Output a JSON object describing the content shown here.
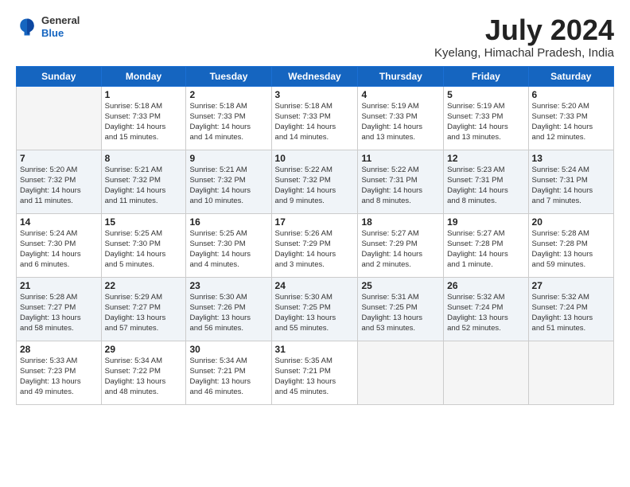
{
  "logo": {
    "general": "General",
    "blue": "Blue"
  },
  "title": "July 2024",
  "location": "Kyelang, Himachal Pradesh, India",
  "days_header": [
    "Sunday",
    "Monday",
    "Tuesday",
    "Wednesday",
    "Thursday",
    "Friday",
    "Saturday"
  ],
  "weeks": [
    [
      {
        "num": "",
        "info": ""
      },
      {
        "num": "1",
        "info": "Sunrise: 5:18 AM\nSunset: 7:33 PM\nDaylight: 14 hours\nand 15 minutes."
      },
      {
        "num": "2",
        "info": "Sunrise: 5:18 AM\nSunset: 7:33 PM\nDaylight: 14 hours\nand 14 minutes."
      },
      {
        "num": "3",
        "info": "Sunrise: 5:18 AM\nSunset: 7:33 PM\nDaylight: 14 hours\nand 14 minutes."
      },
      {
        "num": "4",
        "info": "Sunrise: 5:19 AM\nSunset: 7:33 PM\nDaylight: 14 hours\nand 13 minutes."
      },
      {
        "num": "5",
        "info": "Sunrise: 5:19 AM\nSunset: 7:33 PM\nDaylight: 14 hours\nand 13 minutes."
      },
      {
        "num": "6",
        "info": "Sunrise: 5:20 AM\nSunset: 7:33 PM\nDaylight: 14 hours\nand 12 minutes."
      }
    ],
    [
      {
        "num": "7",
        "info": "Sunrise: 5:20 AM\nSunset: 7:32 PM\nDaylight: 14 hours\nand 11 minutes."
      },
      {
        "num": "8",
        "info": "Sunrise: 5:21 AM\nSunset: 7:32 PM\nDaylight: 14 hours\nand 11 minutes."
      },
      {
        "num": "9",
        "info": "Sunrise: 5:21 AM\nSunset: 7:32 PM\nDaylight: 14 hours\nand 10 minutes."
      },
      {
        "num": "10",
        "info": "Sunrise: 5:22 AM\nSunset: 7:32 PM\nDaylight: 14 hours\nand 9 minutes."
      },
      {
        "num": "11",
        "info": "Sunrise: 5:22 AM\nSunset: 7:31 PM\nDaylight: 14 hours\nand 8 minutes."
      },
      {
        "num": "12",
        "info": "Sunrise: 5:23 AM\nSunset: 7:31 PM\nDaylight: 14 hours\nand 8 minutes."
      },
      {
        "num": "13",
        "info": "Sunrise: 5:24 AM\nSunset: 7:31 PM\nDaylight: 14 hours\nand 7 minutes."
      }
    ],
    [
      {
        "num": "14",
        "info": "Sunrise: 5:24 AM\nSunset: 7:30 PM\nDaylight: 14 hours\nand 6 minutes."
      },
      {
        "num": "15",
        "info": "Sunrise: 5:25 AM\nSunset: 7:30 PM\nDaylight: 14 hours\nand 5 minutes."
      },
      {
        "num": "16",
        "info": "Sunrise: 5:25 AM\nSunset: 7:30 PM\nDaylight: 14 hours\nand 4 minutes."
      },
      {
        "num": "17",
        "info": "Sunrise: 5:26 AM\nSunset: 7:29 PM\nDaylight: 14 hours\nand 3 minutes."
      },
      {
        "num": "18",
        "info": "Sunrise: 5:27 AM\nSunset: 7:29 PM\nDaylight: 14 hours\nand 2 minutes."
      },
      {
        "num": "19",
        "info": "Sunrise: 5:27 AM\nSunset: 7:28 PM\nDaylight: 14 hours\nand 1 minute."
      },
      {
        "num": "20",
        "info": "Sunrise: 5:28 AM\nSunset: 7:28 PM\nDaylight: 13 hours\nand 59 minutes."
      }
    ],
    [
      {
        "num": "21",
        "info": "Sunrise: 5:28 AM\nSunset: 7:27 PM\nDaylight: 13 hours\nand 58 minutes."
      },
      {
        "num": "22",
        "info": "Sunrise: 5:29 AM\nSunset: 7:27 PM\nDaylight: 13 hours\nand 57 minutes."
      },
      {
        "num": "23",
        "info": "Sunrise: 5:30 AM\nSunset: 7:26 PM\nDaylight: 13 hours\nand 56 minutes."
      },
      {
        "num": "24",
        "info": "Sunrise: 5:30 AM\nSunset: 7:25 PM\nDaylight: 13 hours\nand 55 minutes."
      },
      {
        "num": "25",
        "info": "Sunrise: 5:31 AM\nSunset: 7:25 PM\nDaylight: 13 hours\nand 53 minutes."
      },
      {
        "num": "26",
        "info": "Sunrise: 5:32 AM\nSunset: 7:24 PM\nDaylight: 13 hours\nand 52 minutes."
      },
      {
        "num": "27",
        "info": "Sunrise: 5:32 AM\nSunset: 7:24 PM\nDaylight: 13 hours\nand 51 minutes."
      }
    ],
    [
      {
        "num": "28",
        "info": "Sunrise: 5:33 AM\nSunset: 7:23 PM\nDaylight: 13 hours\nand 49 minutes."
      },
      {
        "num": "29",
        "info": "Sunrise: 5:34 AM\nSunset: 7:22 PM\nDaylight: 13 hours\nand 48 minutes."
      },
      {
        "num": "30",
        "info": "Sunrise: 5:34 AM\nSunset: 7:21 PM\nDaylight: 13 hours\nand 46 minutes."
      },
      {
        "num": "31",
        "info": "Sunrise: 5:35 AM\nSunset: 7:21 PM\nDaylight: 13 hours\nand 45 minutes."
      },
      {
        "num": "",
        "info": ""
      },
      {
        "num": "",
        "info": ""
      },
      {
        "num": "",
        "info": ""
      }
    ]
  ]
}
